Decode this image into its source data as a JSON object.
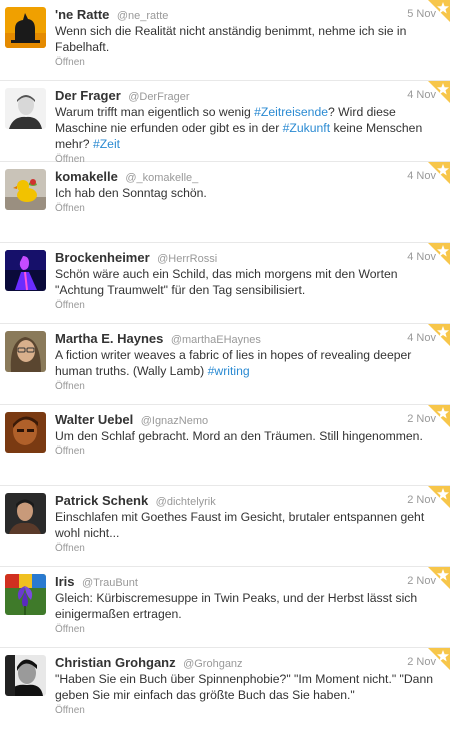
{
  "open_label": "Öffnen",
  "colors": {
    "link": "#2a8ad2",
    "star": "#f5b800",
    "star_corner": "#f7c64a"
  },
  "tweets": [
    {
      "name": "'ne Ratte",
      "handle": "@ne_ratte",
      "date": "5 Nov",
      "avatar_icon": "rat-silhouette-avatar",
      "segments": [
        {
          "text": "Wenn sich die Realität nicht anständig benimmt, nehme ich sie in Fabelhaft.",
          "type": "text"
        }
      ]
    },
    {
      "name": "Der Frager",
      "handle": "@DerFrager",
      "date": "4 Nov",
      "avatar_icon": "person-portrait-avatar",
      "segments": [
        {
          "text": "Warum trifft man eigentlich so wenig ",
          "type": "text"
        },
        {
          "text": "#Zeitreisende",
          "type": "hash"
        },
        {
          "text": "? Wird diese Maschine nie erfunden oder gibt es in der ",
          "type": "text"
        },
        {
          "text": "#Zukunft",
          "type": "hash"
        },
        {
          "text": " keine Menschen mehr? ",
          "type": "text"
        },
        {
          "text": "#Zeit",
          "type": "hash"
        }
      ]
    },
    {
      "name": "komakelle",
      "handle": "@_komakelle_",
      "date": "4 Nov",
      "avatar_icon": "duck-toy-avatar",
      "segments": [
        {
          "text": "Ich hab den Sonntag schön.",
          "type": "text"
        }
      ]
    },
    {
      "name": "Brockenheimer",
      "handle": "@HerrRossi",
      "date": "4 Nov",
      "avatar_icon": "neon-figure-avatar",
      "segments": [
        {
          "text": "Schön wäre auch ein Schild, das mich morgens mit den Worten \"Achtung Traumwelt\" für den Tag sensibilisiert.",
          "type": "text"
        }
      ]
    },
    {
      "name": "Martha E. Haynes",
      "handle": "@marthaEHaynes",
      "date": "4 Nov",
      "avatar_icon": "woman-portrait-avatar",
      "segments": [
        {
          "text": "A fiction writer weaves a fabric of lies in hopes of revealing deeper human truths. (Wally Lamb) ",
          "type": "text"
        },
        {
          "text": "#writing",
          "type": "hash"
        }
      ]
    },
    {
      "name": "Walter Uebel",
      "handle": "@IgnazNemo",
      "date": "2 Nov",
      "avatar_icon": "brown-portrait-avatar",
      "segments": [
        {
          "text": "Um den Schlaf gebracht. Mord an den Träumen. Still hingenommen.",
          "type": "text"
        }
      ]
    },
    {
      "name": "Patrick Schenk",
      "handle": "@dichtelyrik",
      "date": "2 Nov",
      "avatar_icon": "man-portrait-avatar",
      "segments": [
        {
          "text": "Einschlafen mit Goethes Faust im Gesicht, brutaler entspannen geht wohl nicht...",
          "type": "text"
        }
      ]
    },
    {
      "name": "Iris",
      "handle": "@TrauBunt",
      "date": "2 Nov",
      "avatar_icon": "iris-flower-avatar",
      "segments": [
        {
          "text": "Gleich: Kürbiscremesuppe in Twin Peaks, und der Herbst lässt sich einigermaßen ertragen.",
          "type": "text"
        }
      ]
    },
    {
      "name": "Christian Grohganz",
      "handle": "@Grohganz",
      "date": "2 Nov",
      "avatar_icon": "bw-portrait-avatar",
      "segments": [
        {
          "text": "\"Haben Sie ein Buch über Spinnenphobie?\" \"Im Moment nicht.\" \"Dann geben Sie mir einfach das größte Buch das Sie haben.\"",
          "type": "text"
        }
      ]
    }
  ]
}
